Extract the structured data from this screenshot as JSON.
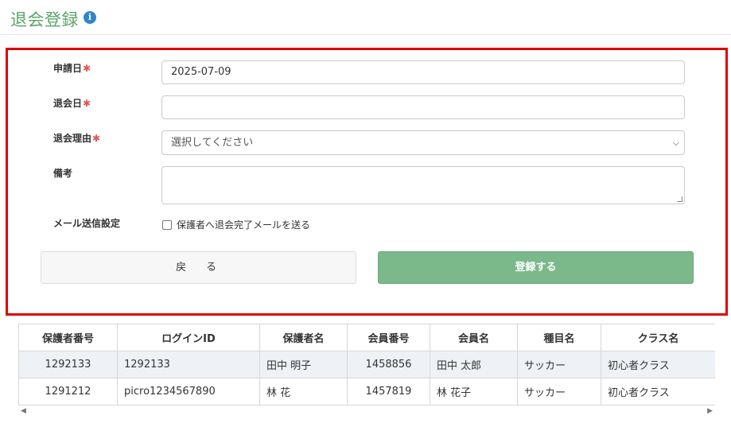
{
  "page": {
    "title": "退会登録",
    "info_icon": "info-icon"
  },
  "form": {
    "application_date": {
      "label": "申請日",
      "required_mark": "✱",
      "value": "2025-07-09"
    },
    "withdrawal_date": {
      "label": "退会日",
      "required_mark": "✱",
      "value": ""
    },
    "reason": {
      "label": "退会理由",
      "required_mark": "✱",
      "selected": "選択してください"
    },
    "notes": {
      "label": "備考",
      "value": ""
    },
    "mail": {
      "label": "メール送信設定",
      "checkbox_label": "保護者へ退会完了メールを送る",
      "checked": false
    },
    "back_label": "戻　る",
    "submit_label": "登録する"
  },
  "table": {
    "headers": [
      "保護者番号",
      "ログインID",
      "保護者名",
      "会員番号",
      "会員名",
      "種目名",
      "クラス名"
    ],
    "rows": [
      [
        "1292133",
        "1292133",
        "田中 明子",
        "1458856",
        "田中 太郎",
        "サッカー",
        "初心者クラス"
      ],
      [
        "1291212",
        "picro1234567890",
        "林 花",
        "1457819",
        "林 花子",
        "サッカー",
        "初心者クラス"
      ]
    ]
  },
  "colors": {
    "accent": "#5aa468",
    "submit": "#7bb88a",
    "highlight_border": "#e00000",
    "required": "#e45353"
  }
}
